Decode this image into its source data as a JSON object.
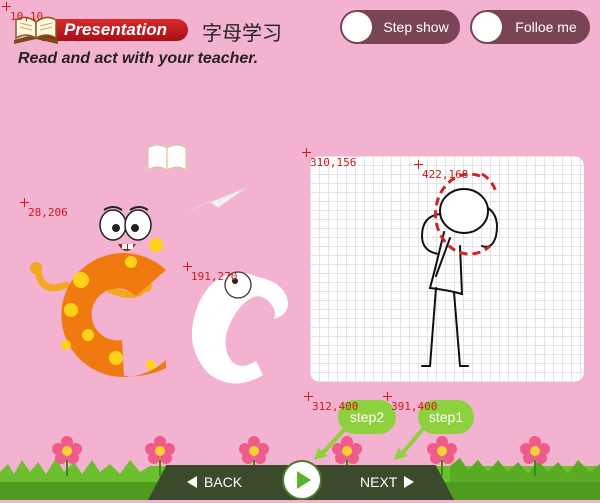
{
  "header": {
    "banner": "Presentation",
    "chinese_title": "字母学习",
    "subtitle": "Read and act with your teacher."
  },
  "toggles": {
    "step_show": "Step show",
    "follow_me": "Folloe me"
  },
  "coords": {
    "book": "10,10",
    "letter": "28,206",
    "eye": "191,270",
    "panel": "310,156",
    "head": "422,168",
    "step2": "312,400",
    "step1": "391,400"
  },
  "steps": {
    "step2": "step2",
    "step1": "step1"
  },
  "nav": {
    "back": "BACK",
    "next": "NEXT"
  },
  "colors": {
    "background": "#f3b3d0",
    "banner": "#c41a22",
    "toggle": "#7a4457",
    "step_bubble": "#8dd13f",
    "nav_bar": "#3a4a2a"
  }
}
